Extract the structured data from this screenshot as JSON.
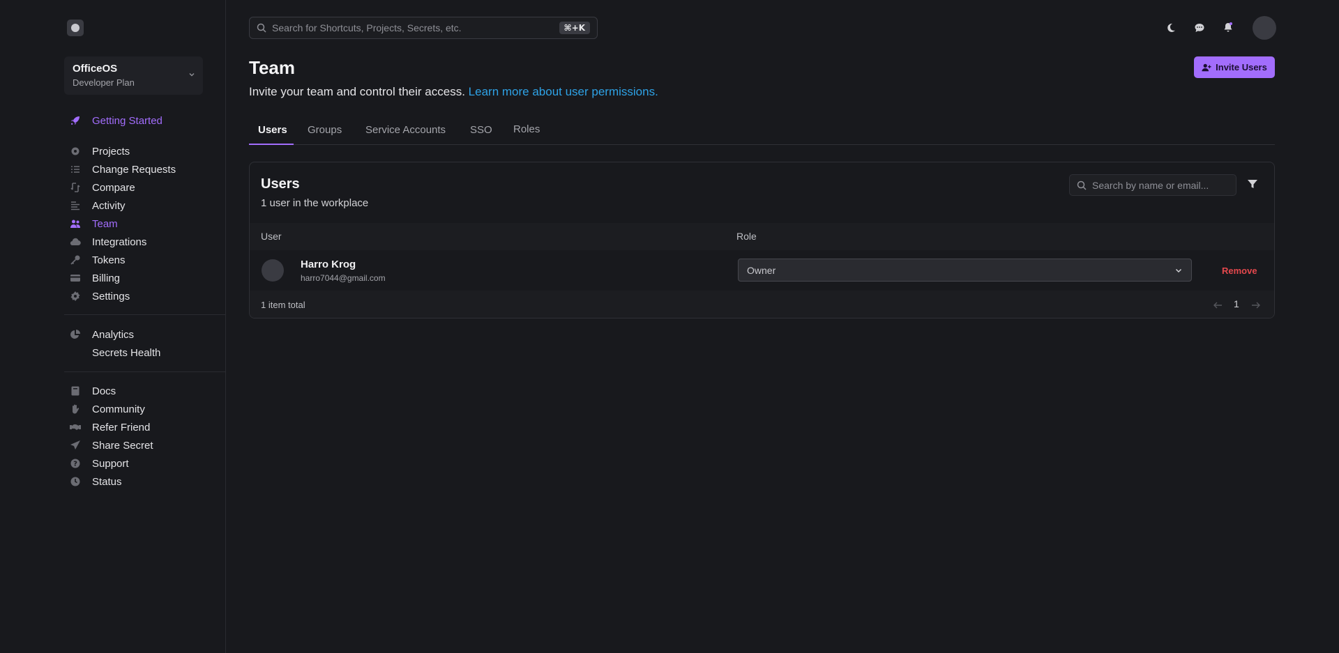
{
  "sidebar": {
    "org": {
      "name": "OfficeOS",
      "plan": "Developer Plan"
    },
    "primary": [
      {
        "label": "Getting Started",
        "icon": "rocket-icon"
      }
    ],
    "main": [
      {
        "label": "Projects",
        "icon": "gear-icon"
      },
      {
        "label": "Change Requests",
        "icon": "list-check-icon"
      },
      {
        "label": "Compare",
        "icon": "compare-icon"
      },
      {
        "label": "Activity",
        "icon": "activity-icon"
      },
      {
        "label": "Team",
        "icon": "users-icon"
      },
      {
        "label": "Integrations",
        "icon": "cloud-icon"
      },
      {
        "label": "Tokens",
        "icon": "key-icon"
      },
      {
        "label": "Billing",
        "icon": "credit-card-icon"
      },
      {
        "label": "Settings",
        "icon": "gear-icon"
      }
    ],
    "analytics": [
      {
        "label": "Analytics",
        "icon": "pie-chart-icon"
      },
      {
        "label": "Secrets Health",
        "icon": ""
      }
    ],
    "resources": [
      {
        "label": "Docs",
        "icon": "book-icon"
      },
      {
        "label": "Community",
        "icon": "hand-icon"
      },
      {
        "label": "Refer Friend",
        "icon": "handshake-icon"
      },
      {
        "label": "Share Secret",
        "icon": "paper-plane-icon"
      },
      {
        "label": "Support",
        "icon": "question-icon"
      },
      {
        "label": "Status",
        "icon": "clock-icon"
      }
    ]
  },
  "topbar": {
    "search_placeholder": "Search for Shortcuts, Projects, Secrets, etc.",
    "shortcut": "⌘+K"
  },
  "header": {
    "title": "Team",
    "subtitle": "Invite your team and control their access.",
    "link": "Learn more about user permissions.",
    "invite_label": "Invite Users"
  },
  "tabs": [
    "Users",
    "Groups",
    "Service Accounts",
    "SSO",
    "Roles"
  ],
  "users_card": {
    "title": "Users",
    "subtitle": "1 user in the workplace",
    "search_placeholder": "Search by name or email...",
    "columns": [
      "User",
      "Role"
    ],
    "rows": [
      {
        "name": "Harro Krog",
        "email": "harro7044@gmail.com",
        "role": "Owner",
        "action": "Remove"
      }
    ],
    "total": "1 item total",
    "page": "1"
  },
  "colors": {
    "accent": "#a26dfc",
    "link": "#2ea2e6",
    "danger": "#e5484d",
    "background": "#18191d"
  }
}
